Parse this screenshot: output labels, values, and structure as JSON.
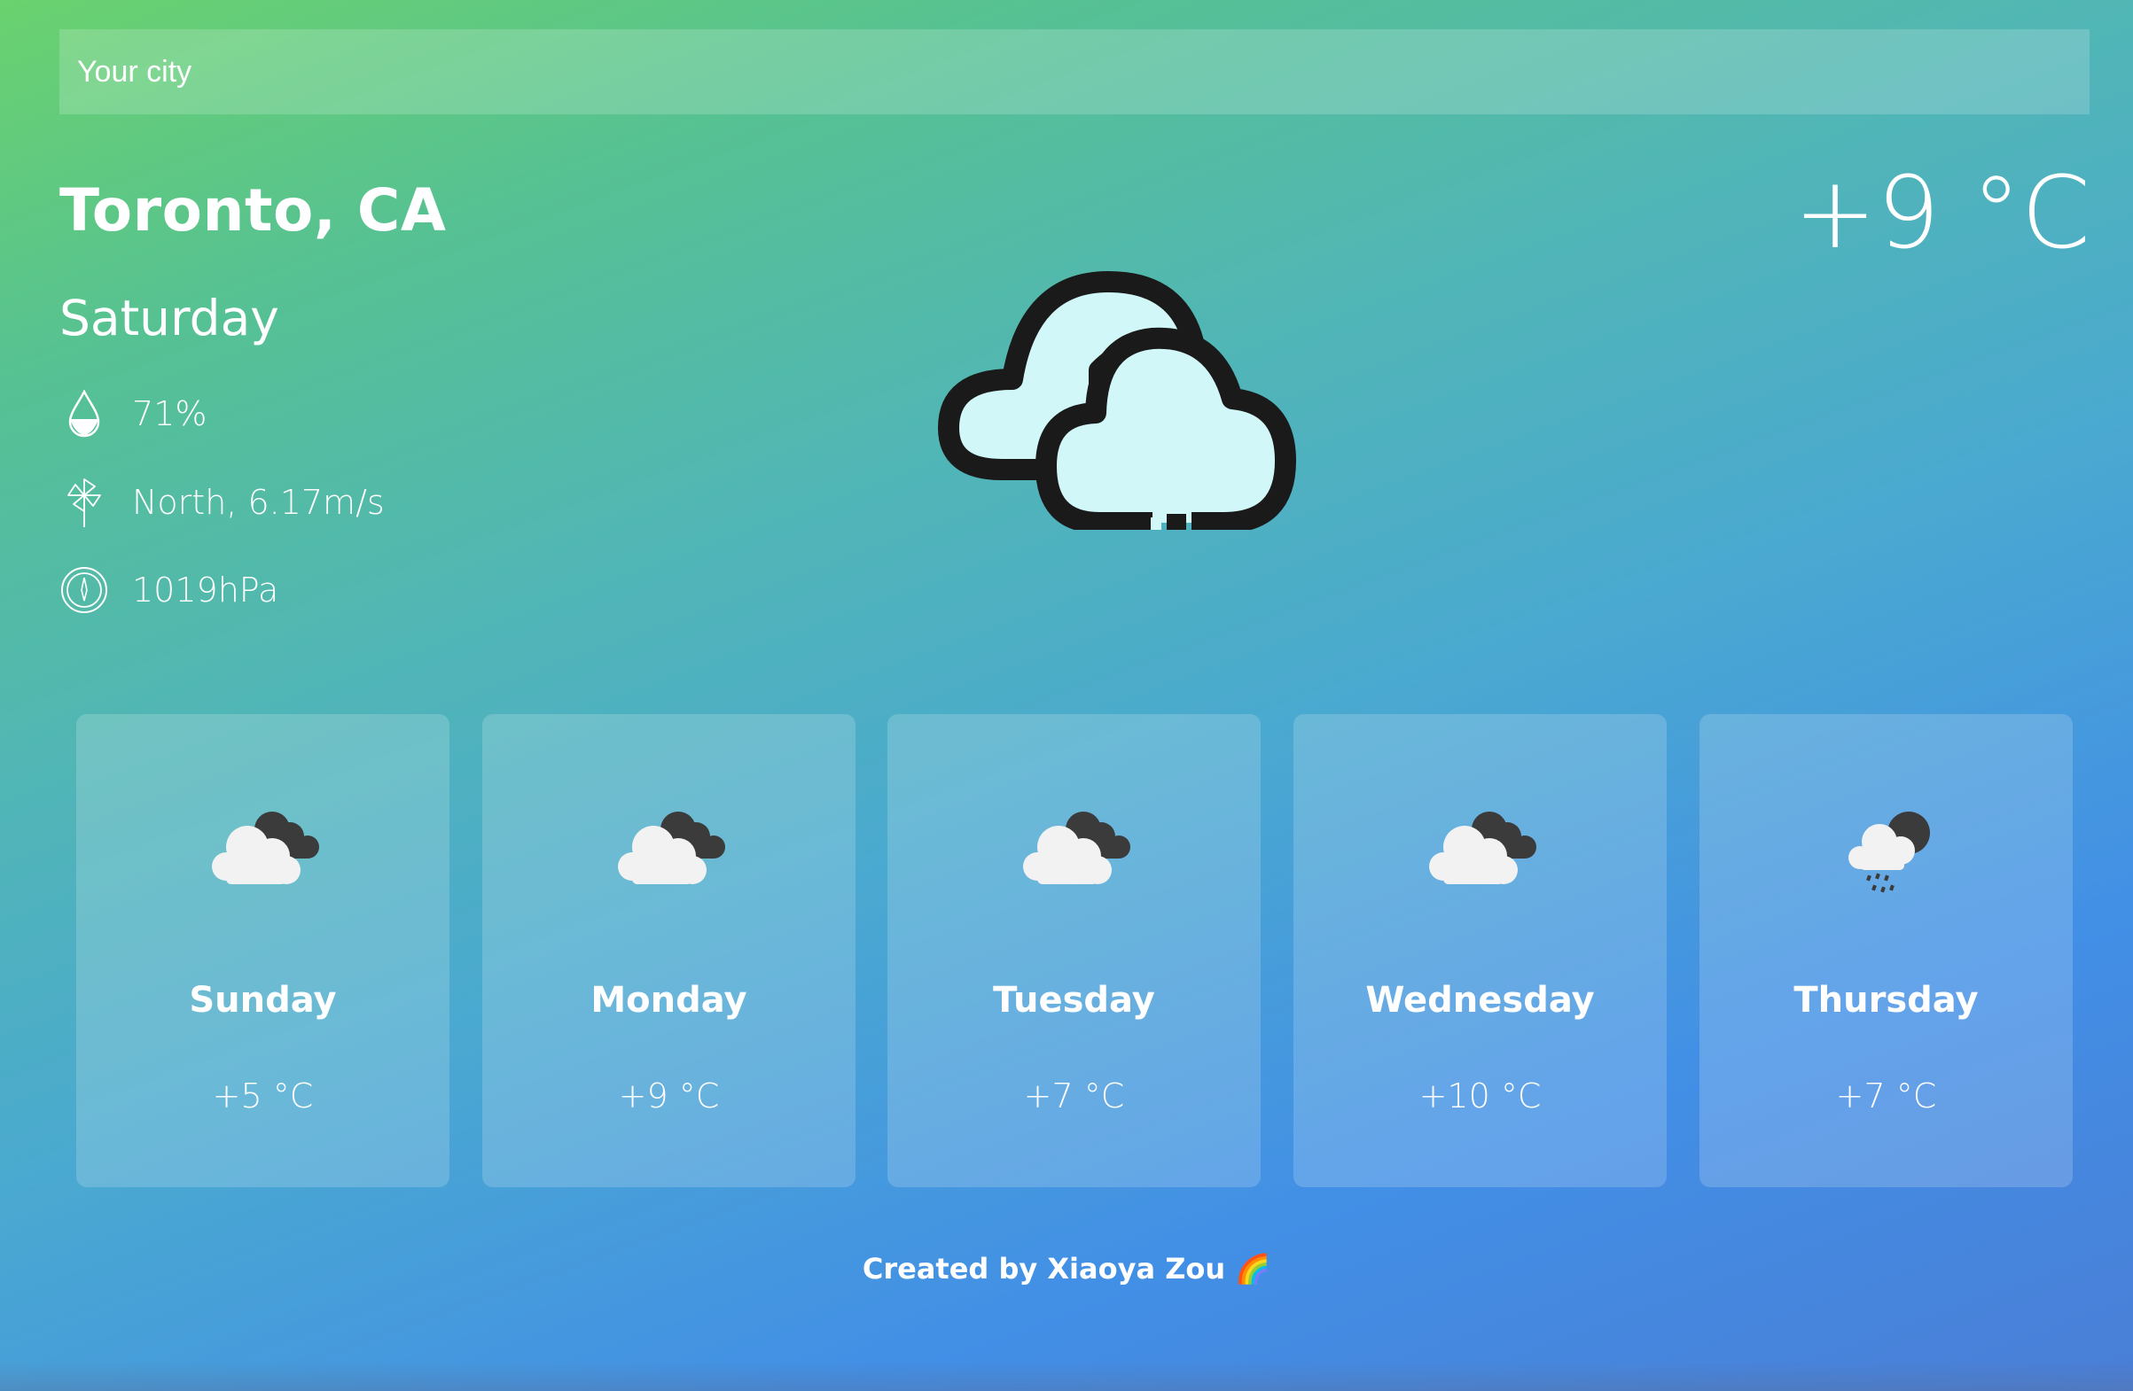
{
  "search": {
    "placeholder": "Your city"
  },
  "current": {
    "city": "Toronto, CA",
    "day": "Saturday",
    "humidity": "71%",
    "wind": "North, 6.17m/s",
    "pressure": "1019hPa",
    "temperature": "+9 °C",
    "icon": "cloudy-icon"
  },
  "forecast": [
    {
      "day": "Sunday",
      "temp": "+5 °C",
      "icon": "partly-cloudy-night-icon"
    },
    {
      "day": "Monday",
      "temp": "+9 °C",
      "icon": "partly-cloudy-night-icon"
    },
    {
      "day": "Tuesday",
      "temp": "+7 °C",
      "icon": "partly-cloudy-night-icon"
    },
    {
      "day": "Wednesday",
      "temp": "+10 °C",
      "icon": "partly-cloudy-night-icon"
    },
    {
      "day": "Thursday",
      "temp": "+7 °C",
      "icon": "rain-night-icon"
    }
  ],
  "footer": {
    "text": "Created by Xiaoya Zou 🌈"
  },
  "colors": {
    "gradient_start": "#6ad26e",
    "gradient_end": "#4a7ed6",
    "icon_outline": "#1a1a1a",
    "icon_fill": "#d2f7f8"
  }
}
